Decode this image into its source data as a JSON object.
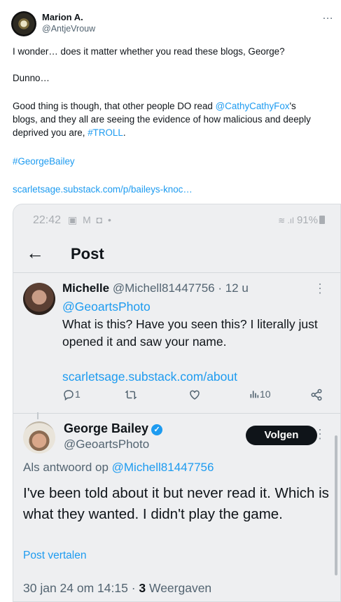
{
  "outer_tweet": {
    "author_name": "Marion A.",
    "author_handle": "@AntjeVrouw",
    "more_icon": "…",
    "line1": "I wonder… does it matter whether you read these blogs, George?",
    "line2": "Dunno…",
    "line3_a": "Good thing is though, that other people DO read ",
    "line3_mention": "@CathyCathyFox",
    "line3_b": "'s",
    "line3_c": "blogs, and they all are seeing the evidence of how malicious and deeply",
    "line3_d": "deprived you are, ",
    "line3_tag": "#TROLL",
    "line3_e": ".",
    "hashtag": "#GeorgeBailey",
    "link": "scarletsage.substack.com/p/baileys-knoc…"
  },
  "screenshot": {
    "status_time": "22:42",
    "status_icons": "▣ M ◘ •",
    "battery": "91%",
    "wifi_signal": "≋ .ıl",
    "back_icon": "←",
    "header_title": "Post",
    "michelle": {
      "name": "Michelle",
      "handle_time": "@Michell81447756 · 12 u",
      "mention": "@GeoartsPhoto",
      "text": "What is this?  Have you seen this?  I literally just opened it and saw your name.",
      "link": "scarletsage.substack.com/about",
      "reply_count": "1",
      "views": "10",
      "more_icon": "⋮"
    },
    "george": {
      "name": "George Bailey",
      "handle": "@GeoartsPhoto",
      "follow_label": "Volgen",
      "reply_to_prefix": "Als antwoord op ",
      "reply_to_handle": "@Michell81447756",
      "text": "I've been told about it but never read it. Which is what they wanted.  I didn't play the game.",
      "translate_label": "Post vertalen",
      "meta_date": "30 jan 24 om 14:15 · ",
      "meta_views_count": "3",
      "meta_views_label": " Weergaven",
      "more_icon": "⋮",
      "verified_icon": "✓"
    }
  },
  "colors": {
    "link": "#1d9bf0",
    "text": "#0f1419",
    "secondary": "#536471",
    "screenshot_bg": "#eeeff1"
  }
}
